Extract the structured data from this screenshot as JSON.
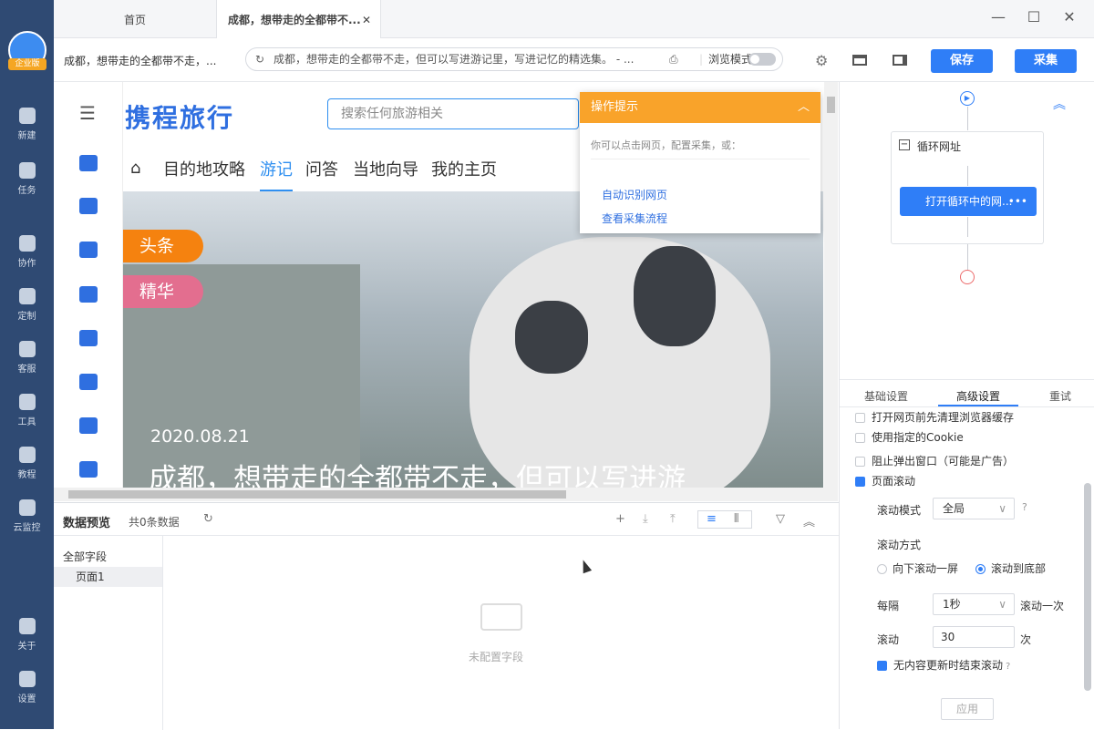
{
  "sidebar": {
    "badge": "企业版",
    "items": [
      {
        "label": "新建",
        "icon": "plus-icon"
      },
      {
        "label": "任务",
        "icon": "task-icon"
      },
      {
        "label": "协作",
        "icon": "users-icon"
      },
      {
        "label": "定制",
        "icon": "heart-icon"
      },
      {
        "label": "客服",
        "icon": "headset-icon"
      },
      {
        "label": "工具",
        "icon": "toolbox-icon"
      },
      {
        "label": "教程",
        "icon": "graduation-icon"
      },
      {
        "label": "云监控",
        "icon": "cloud-monitor-icon"
      },
      {
        "label": "关于",
        "icon": "info-icon"
      },
      {
        "label": "设置",
        "icon": "gear-icon"
      }
    ]
  },
  "tabs": [
    {
      "label": "首页"
    },
    {
      "label": "成都，想带走的全都带不..."
    }
  ],
  "window": {
    "minimize": "—",
    "maximize": "☐",
    "close": "✕"
  },
  "address": {
    "page_title": "成都，想带走的全都带不走，...",
    "url": "成都，想带走的全都带不走，但可以写进游记里，写进记忆的精选集。 - ...",
    "browse_mode": "浏览模式",
    "save": "保存",
    "collect": "采集"
  },
  "site": {
    "logo": "携程旅行",
    "search_placeholder": "搜索任何旅游相关",
    "nav": [
      "目的地攻略",
      "游记",
      "问答",
      "当地向导",
      "我的主页"
    ],
    "tags": [
      "头条",
      "精华"
    ],
    "date": "2020.08.21",
    "title": "成都，想带走的全都带不走，但可以写进游"
  },
  "tips": {
    "title": "操作提示",
    "desc": "你可以点击网页，配置采集，或：",
    "links": [
      "自动识别网页",
      "查看采集流程"
    ]
  },
  "preview": {
    "title": "数据预览",
    "count": "共0条数据",
    "all_fields": "全部字段",
    "page": "页面1",
    "empty": "未配置字段"
  },
  "flow": {
    "loop": "循环网址",
    "open": "打开循环中的网...",
    "more": "•••"
  },
  "settings": {
    "tabs": [
      "基础设置",
      "高级设置",
      "重试"
    ],
    "opt_clear": "打开网页前先清理浏览器缓存",
    "opt_cookie": "使用指定的Cookie",
    "opt_block": "阻止弹出窗口（可能是广告）",
    "opt_scroll": "页面滚动",
    "scroll_mode_label": "滚动模式",
    "scroll_mode_value": "全局",
    "scroll_way_label": "滚动方式",
    "scroll_way_1": "向下滚动一屏",
    "scroll_way_2": "滚动到底部",
    "interval_label": "每隔",
    "interval_value": "1秒",
    "interval_suffix": "滚动一次",
    "times_label": "滚动",
    "times_value": "30",
    "times_suffix": "次",
    "opt_stop": "无内容更新时结束滚动",
    "apply": "应用"
  }
}
